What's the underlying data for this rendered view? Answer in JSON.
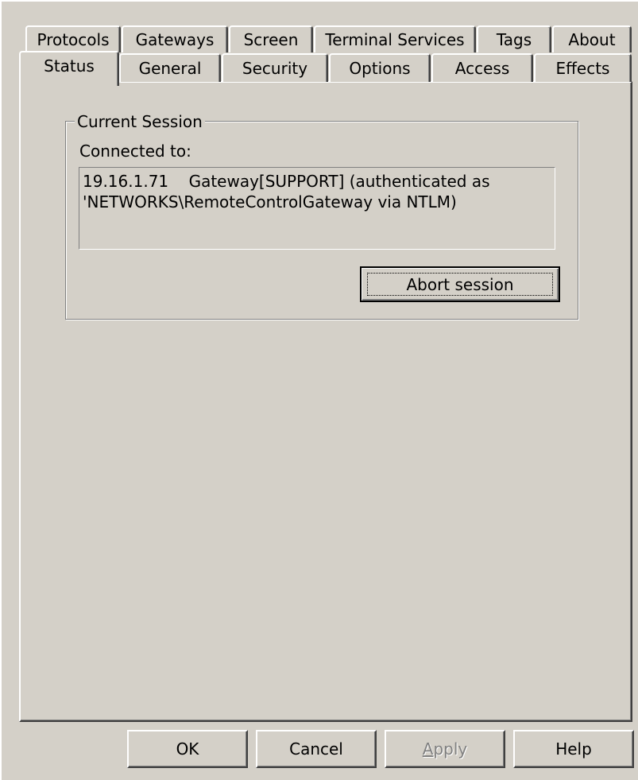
{
  "tabs_back": [
    {
      "label": "Protocols"
    },
    {
      "label": "Gateways"
    },
    {
      "label": "Screen"
    },
    {
      "label": "Terminal Services"
    },
    {
      "label": "Tags"
    },
    {
      "label": "About"
    }
  ],
  "tabs_front": [
    {
      "label": "Status"
    },
    {
      "label": "General"
    },
    {
      "label": "Security"
    },
    {
      "label": "Options"
    },
    {
      "label": "Access"
    },
    {
      "label": "Effects"
    }
  ],
  "selected_tab": "Status",
  "session": {
    "group_title": "Current Session",
    "connected_label": "Connected to:",
    "connection_line1": "19.16.1.71    Gateway[SUPPORT] (authenticated as",
    "connection_line2": "'NETWORKS\\RemoteControlGateway via NTLM)",
    "abort_label": "Abort session"
  },
  "buttons": {
    "ok": "OK",
    "cancel": "Cancel",
    "apply_first": "A",
    "apply_rest": "pply",
    "help": "Help"
  }
}
